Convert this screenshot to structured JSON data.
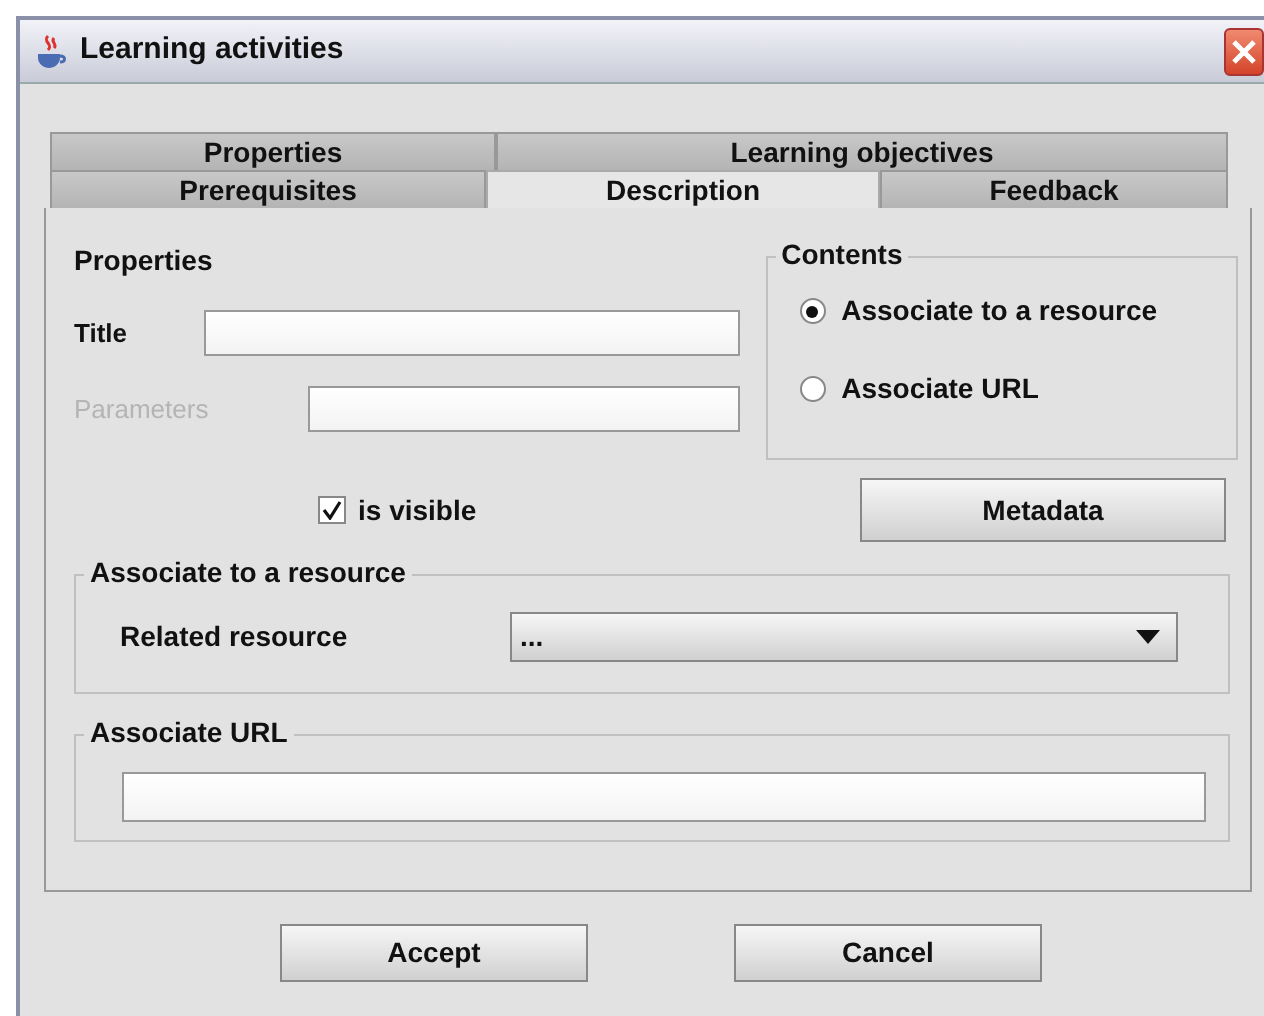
{
  "window": {
    "title": "Learning activities"
  },
  "tab_rows": [
    [
      {
        "label": "Properties",
        "selected": false
      },
      {
        "label": "Learning objectives",
        "selected": false
      }
    ],
    [
      {
        "label": "Prerequisites",
        "selected": false
      },
      {
        "label": "Description",
        "selected": true
      },
      {
        "label": "Feedback",
        "selected": false
      }
    ]
  ],
  "properties": {
    "heading": "Properties",
    "fields": [
      {
        "label": "Title",
        "disabled": false
      },
      {
        "label": "Parameters",
        "disabled": true
      }
    ]
  },
  "contents": {
    "legend": "Contents",
    "options": [
      {
        "label": "Associate to a resource",
        "selected": true
      },
      {
        "label": "Associate URL",
        "selected": false
      }
    ]
  },
  "visible_checkbox": {
    "label": "is visible",
    "checked": true
  },
  "metadata_button": "Metadata",
  "resource_group": {
    "legend": "Associate to a resource",
    "label": "Related resource",
    "value": "..."
  },
  "url_group": {
    "legend": "Associate URL"
  },
  "buttons": [
    "Accept",
    "Cancel"
  ]
}
